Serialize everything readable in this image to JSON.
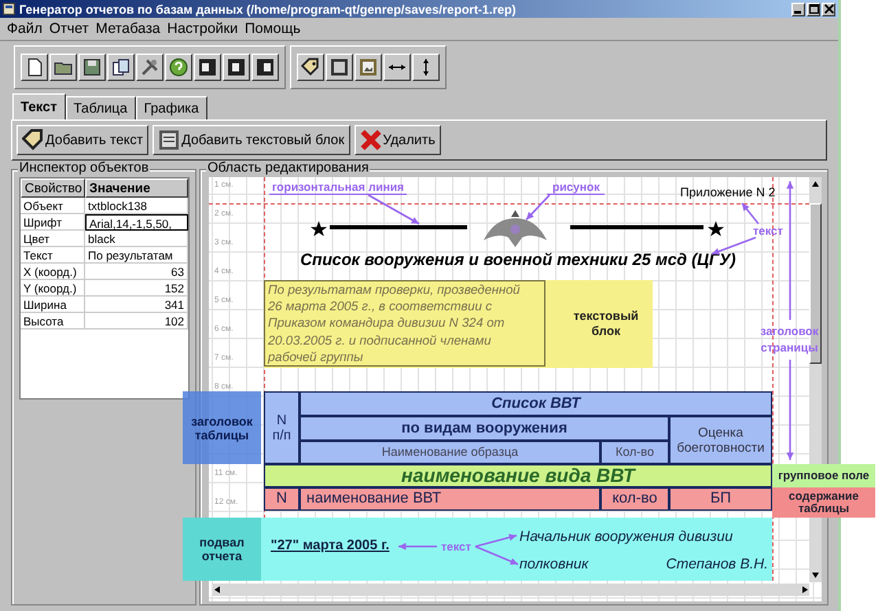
{
  "window": {
    "title": "Генератор отчетов по базам данных (/home/program-qt/genrep/saves/report-1.rep)"
  },
  "menu": [
    "Файл",
    "Отчет",
    "Метабаза",
    "Настройки",
    "Помощь"
  ],
  "tabs": [
    {
      "label": "Текст",
      "selected": true
    },
    {
      "label": "Таблица",
      "selected": false
    },
    {
      "label": "Графика",
      "selected": false
    }
  ],
  "actions": [
    {
      "kind": "add-text",
      "label": "Добавить текст"
    },
    {
      "kind": "add-block",
      "label": "Добавить текстовый блок"
    },
    {
      "kind": "delete",
      "label": "Удалить"
    }
  ],
  "inspector": {
    "title": "Инспектор объектов",
    "columns": [
      "Свойство",
      "Значение"
    ],
    "rows": [
      {
        "property": "Объект",
        "value": "txtblock138",
        "kind": "text",
        "selected": false
      },
      {
        "property": "Шрифт",
        "value": "Arial,14,-1,5,50,",
        "kind": "text",
        "selected": true
      },
      {
        "property": "Цвет",
        "value": "black",
        "kind": "text",
        "selected": false
      },
      {
        "property": "Текст",
        "value": "По результатам",
        "kind": "text",
        "selected": false
      },
      {
        "property": "X (коорд.)",
        "value": "63",
        "kind": "number",
        "selected": false
      },
      {
        "property": "Y (коорд.)",
        "value": "152",
        "kind": "number",
        "selected": false
      },
      {
        "property": "Ширина",
        "value": "341",
        "kind": "number",
        "selected": false
      },
      {
        "property": "Высота",
        "value": "102",
        "kind": "number",
        "selected": false
      }
    ]
  },
  "editor": {
    "title": "Область редактирования",
    "ruler_top": [
      "1 см.",
      "2 см.",
      "3 см.",
      "4 см.",
      "5 см.",
      "6 см.",
      "7 см.",
      "8 см."
    ],
    "ruler_bottom": [
      "11 см.",
      "12 см."
    ],
    "appendix": "Приложение N 2",
    "heading": "Список вооружения и военной техники 25 мсд (ЦГУ)",
    "text_block": "По результатам проверки, прозведенной 26 марта 2005 г., в соответствии с Приказом командира дивизии N 324 от 20.03.2005 г. и подписанной членами рабочей группы",
    "table": {
      "title": "Список ВВТ",
      "group_header": "по видам вооружения",
      "columns": [
        "N п/п",
        "Наименование образца",
        "Кол-во",
        "Оценка боеготовности"
      ],
      "group_row": "наименование вида ВВТ",
      "row": [
        "N",
        "наименование ВВТ",
        "кол-во",
        "БП"
      ]
    },
    "footer": {
      "date": "\"27\" марта 2005 г.",
      "position": "Начальник вооружения дивизии",
      "rank": "полковник",
      "name": "Степанов В.Н."
    },
    "annotations": {
      "horizontal_line": "горизонтальная линия",
      "picture": "рисунок",
      "header_text": "текст",
      "page_header": "заголовок страницы",
      "text_block": "текстовый блок",
      "table_header": "заголовок таблицы",
      "group_field": "групповое поле",
      "table_body": "содержание таблицы",
      "report_footer": "подвал отчета",
      "footer_text": "текст"
    }
  }
}
